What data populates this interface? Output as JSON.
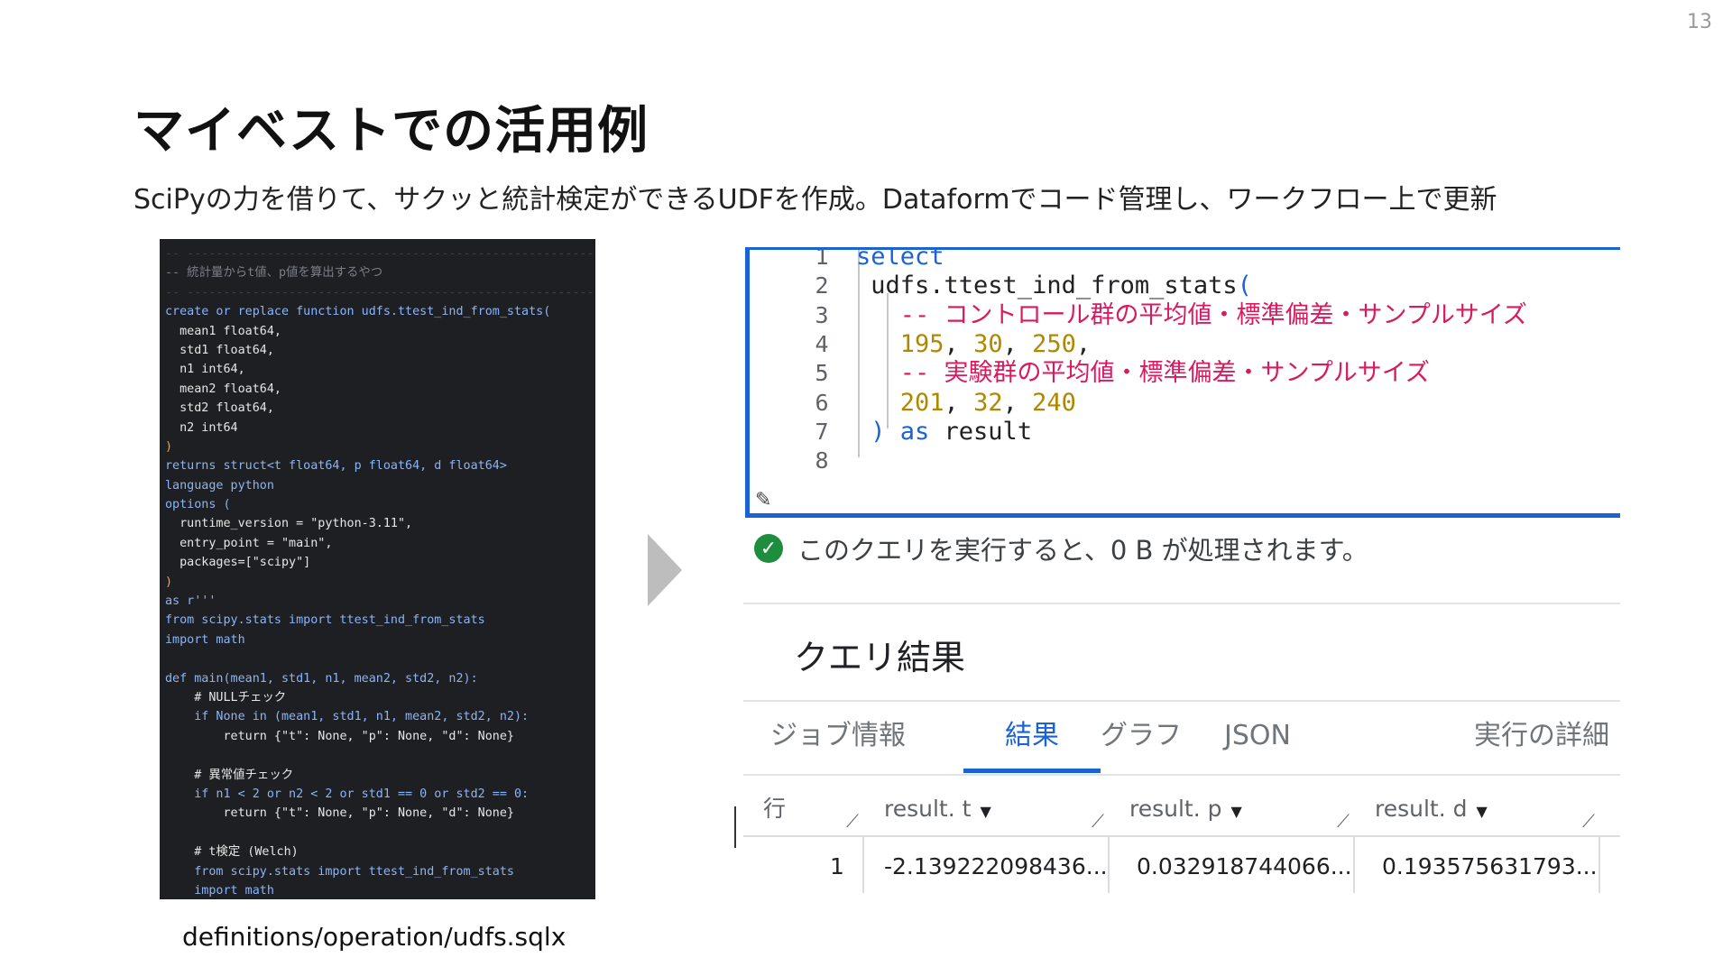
{
  "page_number": "13",
  "title": "マイベストでの活用例",
  "subtitle": "SciPyの力を借りて、サクッと統計検定ができるUDFを作成。Dataformでコード管理し、ワークフロー上で更新",
  "code_caption": "definitions/operation/udfs.sqlx",
  "code_lines": [
    {
      "cls": "dash",
      "t": "-- ---------------------------------------------------------------------------"
    },
    {
      "cls": "c-com",
      "t": "-- 統計量からt値、p値を算出するやつ"
    },
    {
      "cls": "dash",
      "t": "-- ---------------------------------------------------------------------------"
    },
    {
      "cls": "c-key",
      "t": "create or replace function udfs.ttest_ind_from_stats("
    },
    {
      "cls": "c-txt",
      "t": "  mean1 float64,"
    },
    {
      "cls": "c-txt",
      "t": "  std1 float64,"
    },
    {
      "cls": "c-txt",
      "t": "  n1 int64,"
    },
    {
      "cls": "c-txt",
      "t": "  mean2 float64,"
    },
    {
      "cls": "c-txt",
      "t": "  std2 float64,"
    },
    {
      "cls": "c-txt",
      "t": "  n2 int64"
    },
    {
      "cls": "c-pun",
      "t": ")"
    },
    {
      "cls": "c-key",
      "t": "returns struct<t float64, p float64, d float64>"
    },
    {
      "cls": "c-key",
      "t": "language python"
    },
    {
      "cls": "c-key",
      "t": "options ("
    },
    {
      "cls": "c-txt",
      "t": "  runtime_version = \"python-3.11\","
    },
    {
      "cls": "c-txt",
      "t": "  entry_point = \"main\","
    },
    {
      "cls": "c-txt",
      "t": "  packages=[\"scipy\"]"
    },
    {
      "cls": "c-pun",
      "t": ")"
    },
    {
      "cls": "c-key",
      "t": "as r'''"
    },
    {
      "cls": "c-key",
      "t": "from scipy.stats import ttest_ind_from_stats"
    },
    {
      "cls": "c-key",
      "t": "import math"
    },
    {
      "cls": "c-txt",
      "t": ""
    },
    {
      "cls": "c-key",
      "t": "def main(mean1, std1, n1, mean2, std2, n2):"
    },
    {
      "cls": "c-txt",
      "t": "    # NULLチェック"
    },
    {
      "cls": "c-key",
      "t": "    if None in (mean1, std1, n1, mean2, std2, n2):"
    },
    {
      "cls": "c-txt",
      "t": "        return {\"t\": None, \"p\": None, \"d\": None}"
    },
    {
      "cls": "c-txt",
      "t": ""
    },
    {
      "cls": "c-txt",
      "t": "    # 異常値チェック"
    },
    {
      "cls": "c-key",
      "t": "    if n1 < 2 or n2 < 2 or std1 == 0 or std2 == 0:"
    },
    {
      "cls": "c-txt",
      "t": "        return {\"t\": None, \"p\": None, \"d\": None}"
    },
    {
      "cls": "c-txt",
      "t": ""
    },
    {
      "cls": "c-txt",
      "t": "    # t検定 (Welch)"
    },
    {
      "cls": "c-key",
      "t": "    from scipy.stats import ttest_ind_from_stats"
    },
    {
      "cls": "c-key",
      "t": "    import math"
    }
  ],
  "editor": {
    "line_numbers": [
      "1",
      "2",
      "3",
      "4",
      "5",
      "6",
      "7",
      "8"
    ],
    "lines": [
      {
        "parts": [
          {
            "c": "k-blue",
            "t": "select"
          }
        ]
      },
      {
        "parts": [
          {
            "c": "k-plain",
            "t": " udfs.ttest_ind_from_stats"
          },
          {
            "c": "k-blue",
            "t": "("
          }
        ]
      },
      {
        "parts": [
          {
            "c": "k-pink",
            "t": "   -- コントロール群の平均値・標準偏差・サンプルサイズ"
          }
        ]
      },
      {
        "parts": [
          {
            "c": "k-num",
            "t": "   195"
          },
          {
            "c": "k-plain",
            "t": ", "
          },
          {
            "c": "k-num",
            "t": "30"
          },
          {
            "c": "k-plain",
            "t": ", "
          },
          {
            "c": "k-num",
            "t": "250"
          },
          {
            "c": "k-plain",
            "t": ","
          }
        ]
      },
      {
        "parts": [
          {
            "c": "k-pink",
            "t": "   -- 実験群の平均値・標準偏差・サンプルサイズ"
          }
        ]
      },
      {
        "parts": [
          {
            "c": "k-num",
            "t": "   201"
          },
          {
            "c": "k-plain",
            "t": ", "
          },
          {
            "c": "k-num",
            "t": "32"
          },
          {
            "c": "k-plain",
            "t": ", "
          },
          {
            "c": "k-num",
            "t": "240"
          }
        ]
      },
      {
        "parts": [
          {
            "c": "k-blue",
            "t": " ) as"
          },
          {
            "c": "k-plain",
            "t": " result"
          }
        ]
      },
      {
        "parts": []
      }
    ]
  },
  "validator_text": "このクエリを実行すると、0 B が処理されます。",
  "results_title": "クエリ結果",
  "tabs": [
    "ジョブ情報",
    "結果",
    "グラフ",
    "JSON",
    "実行の詳細"
  ],
  "table": {
    "headers": [
      "行",
      "result. t",
      "result. p",
      "result. d"
    ],
    "row": [
      "1",
      "-2.139222098436...",
      "0.032918744066...",
      "0.193575631793..."
    ]
  }
}
